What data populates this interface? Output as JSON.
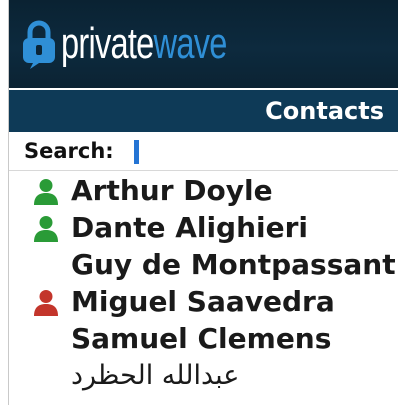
{
  "app": {
    "logo_word_1": "private",
    "logo_word_2": "wave",
    "logo_icon": "lock-icon",
    "colors": {
      "header_bg": "#0b2536",
      "titlebar_bg": "#0e3a57",
      "logo_accent": "#2f8fd6",
      "caret": "#2474d4",
      "online": "#2a9b37",
      "busy": "#c3352b"
    }
  },
  "header": {
    "title": "Contacts"
  },
  "search": {
    "label": "Search:",
    "value": ""
  },
  "contacts": [
    {
      "name": "Arthur Doyle",
      "status": "online",
      "icon": "user-icon-green"
    },
    {
      "name": "Dante Alighieri",
      "status": "online",
      "icon": "user-icon-green"
    },
    {
      "name": "Guy de Montpassant",
      "status": "none",
      "icon": ""
    },
    {
      "name": "Miguel Saavedra",
      "status": "busy",
      "icon": "user-icon-red"
    },
    {
      "name": "Samuel Clemens",
      "status": "none",
      "icon": ""
    },
    {
      "name": "عبدالله الحظرد",
      "status": "none",
      "icon": ""
    }
  ]
}
